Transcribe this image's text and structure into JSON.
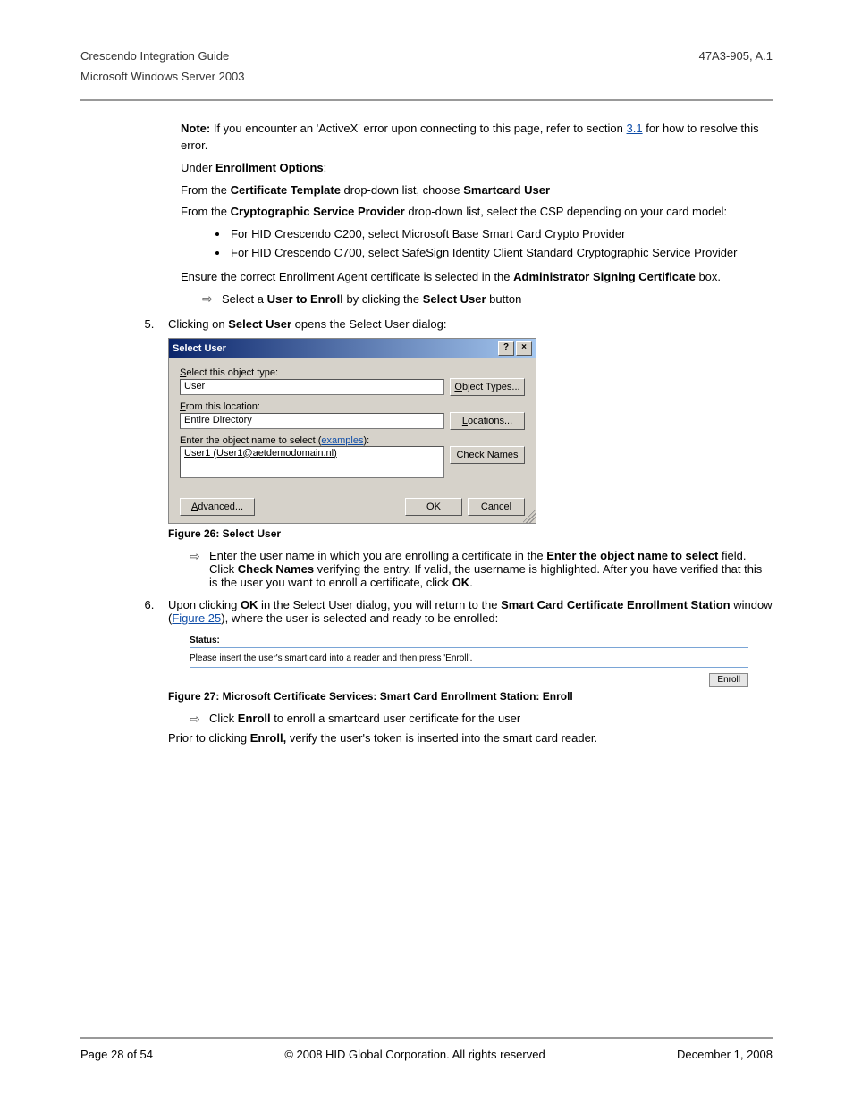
{
  "header": {
    "title_left": "Crescendo Integration Guide",
    "title_right": "47A3-905, A.1",
    "sub_left": "Microsoft Windows Server 2003"
  },
  "note": {
    "label": "Note:",
    "text1": " If you encounter an 'ActiveX' error upon connecting to this page, refer to section ",
    "link": "3.1",
    "text2": " for how to resolve this error."
  },
  "enroll_opts": {
    "intro1a": "Under ",
    "intro1b": "Enrollment Options",
    "intro1c": ":",
    "l2a": "From the ",
    "l2b": "Certificate Template",
    "l2c": " drop-down list, choose ",
    "l2d": "Smartcard User",
    "l3a": "From the ",
    "l3b": "Cryptographic Service Provider",
    "l3c": " drop-down list, select the CSP depending on your card model:",
    "b1": "For HID Crescendo C200, select Microsoft Base Smart Card Crypto Provider",
    "b2": "For HID Crescendo C700, select SafeSign Identity Client Standard Cryptographic Service Provider",
    "l4a": "Ensure the correct Enrollment Agent certificate is selected in the ",
    "l4b": "Administrator Signing Certificate",
    "l4c": " box.",
    "ar1a": "Select a ",
    "ar1b": "User to Enroll",
    "ar1c": " by clicking the ",
    "ar1d": "Select User",
    "ar1e": " button"
  },
  "step5": {
    "text_a": "Clicking on ",
    "text_b": "Select User",
    "text_c": " opens the Select User dialog:"
  },
  "dialog": {
    "title": "Select User",
    "lbl_type_a": "S",
    "lbl_type_b": "elect this object type:",
    "val_type": "User",
    "btn_types_a": "O",
    "btn_types_b": "bject Types...",
    "lbl_from_a": "F",
    "lbl_from_b": "rom this location:",
    "val_from": "Entire Directory",
    "btn_loc_a": "L",
    "btn_loc_b": "ocations...",
    "lbl_name": "Enter the object name to select (",
    "lbl_name_link": "examples",
    "lbl_name_end": "):",
    "val_name": "User1 (User1@aetdemodomain.nl)",
    "btn_check_a": "C",
    "btn_check_b": "heck Names",
    "btn_adv_a": "A",
    "btn_adv_b": "dvanced...",
    "btn_ok": "OK",
    "btn_cancel": "Cancel"
  },
  "fig26_caption": "Figure 26: Select User",
  "after26": {
    "ar_a": "Enter the user name in which you are enrolling a certificate in the ",
    "ar_b": "Enter the object name to select",
    "ar_c": " field. Click ",
    "ar_d": "Check Names",
    "ar_e": " verifying the entry. If valid, the username is highlighted. After you have verified that this is the user you want to enroll a certificate, click ",
    "ar_f": "OK",
    "ar_g": "."
  },
  "step6": {
    "a": "Upon clicking ",
    "b": "OK",
    "c": " in the Select User dialog, you will return to the ",
    "d": "Smart Card Certificate Enrollment Station",
    "e": " window (",
    "link": "Figure 25",
    "f": "), where the user is selected and ready to be enrolled:"
  },
  "fig27": {
    "status_label": "Status:",
    "status_msg": "Please insert the user's smart card into a reader and then press 'Enroll'.",
    "enroll_btn": "Enroll"
  },
  "fig27_caption": "Figure 27: Microsoft Certificate Services: Smart Card Enrollment Station: Enroll",
  "after27": {
    "ar_a": "Click ",
    "ar_b": "Enroll",
    "ar_c": " to enroll a smartcard user certificate for the user",
    "p2_a": "Prior to clicking ",
    "p2_b": "Enroll,",
    "p2_c": " verify the user's token is inserted into the smart card reader."
  },
  "footer": {
    "left": "Page 28 of 54",
    "center": "© 2008 HID Global Corporation.  All rights reserved",
    "right": "December 1, 2008"
  }
}
